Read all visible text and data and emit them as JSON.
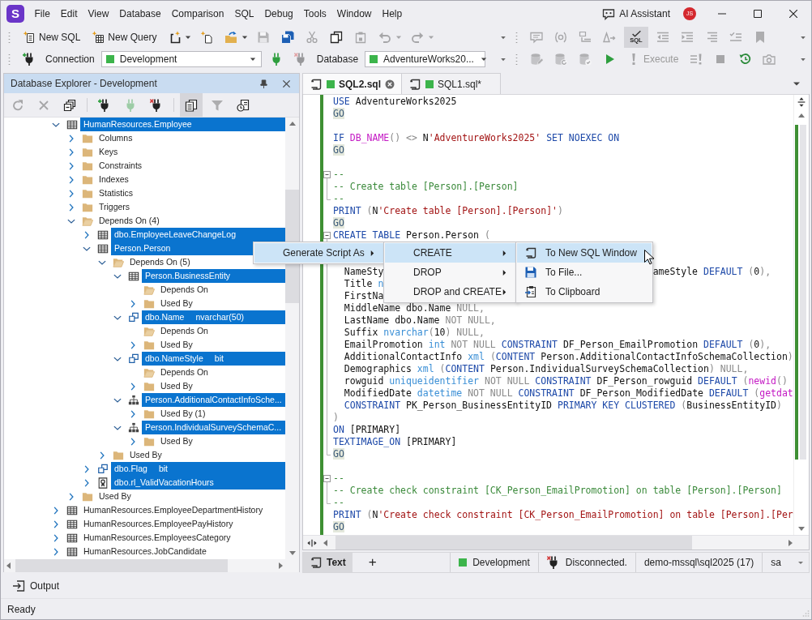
{
  "app": {
    "logo": "S",
    "menu": [
      "File",
      "Edit",
      "View",
      "Database",
      "Comparison",
      "SQL",
      "Debug",
      "Tools",
      "Window",
      "Help"
    ],
    "assistant": "AI Assistant",
    "user_initials": "JS"
  },
  "toolbars": [
    {
      "left": [
        {
          "kind": "new-sql",
          "label": "New SQL",
          "disabled": false,
          "pressed": false
        },
        {
          "kind": "new-query",
          "label": "New Query",
          "disabled": false,
          "pressed": false
        },
        {
          "kind": "new-object",
          "disabled": false,
          "pressed": false
        },
        {
          "kind": "caret",
          "disabled": false,
          "pressed": false
        },
        {
          "kind": "new-file",
          "disabled": false,
          "pressed": false
        },
        {
          "kind": "open",
          "disabled": false,
          "pressed": false
        },
        {
          "kind": "caret",
          "disabled": false,
          "pressed": false
        },
        {
          "kind": "save",
          "disabled": true,
          "pressed": false
        },
        {
          "kind": "save-all",
          "disabled": false,
          "pressed": false
        },
        {
          "kind": "cut",
          "disabled": true,
          "pressed": false
        },
        {
          "kind": "copy",
          "disabled": false,
          "pressed": false
        },
        {
          "kind": "paste",
          "disabled": true,
          "pressed": false
        },
        {
          "kind": "undo",
          "disabled": true,
          "pressed": false
        },
        {
          "kind": "caret",
          "disabled": true,
          "pressed": false
        },
        {
          "kind": "redo",
          "disabled": true,
          "pressed": false
        },
        {
          "kind": "caret",
          "disabled": true,
          "pressed": false
        },
        {
          "kind": "overflow",
          "disabled": false,
          "pressed": false
        }
      ],
      "right": [
        {
          "kind": "comment",
          "disabled": true,
          "pressed": false
        },
        {
          "kind": "params",
          "disabled": true,
          "pressed": false
        },
        {
          "kind": "text-block",
          "disabled": true,
          "pressed": false
        },
        {
          "kind": "format",
          "disabled": true,
          "pressed": false
        },
        {
          "kind": "sql-check",
          "label": "SQL",
          "disabled": false,
          "pressed": true
        },
        {
          "kind": "outdent",
          "disabled": true,
          "pressed": false
        },
        {
          "kind": "indent",
          "disabled": true,
          "pressed": false
        },
        {
          "kind": "align",
          "disabled": true,
          "pressed": false
        },
        {
          "kind": "checklist",
          "disabled": true,
          "pressed": false
        },
        {
          "kind": "bookmark",
          "disabled": true,
          "pressed": false
        },
        {
          "kind": "overflow",
          "disabled": false,
          "pressed": false
        }
      ]
    },
    {
      "left": [
        {
          "kind": "plug-add",
          "disabled": false,
          "pressed": false
        },
        {
          "kind": "label",
          "label": "Connection",
          "disabled": false,
          "pressed": false
        },
        {
          "kind": "select",
          "value": "Development",
          "color": "#3cb44b",
          "disabled": false,
          "pressed": false
        },
        {
          "kind": "plug",
          "disabled": false,
          "pressed": false
        },
        {
          "kind": "plug-remove",
          "disabled": true,
          "pressed": false
        },
        {
          "kind": "label",
          "label": "Database",
          "disabled": false,
          "pressed": false
        },
        {
          "kind": "select",
          "value": "AdventureWorks20...",
          "color": "#3cb44b",
          "disabled": false,
          "pressed": false
        },
        {
          "kind": "overflow",
          "disabled": false,
          "pressed": false
        }
      ],
      "right": [
        {
          "kind": "db-edit",
          "disabled": true,
          "pressed": false
        },
        {
          "kind": "db-refresh",
          "disabled": true,
          "pressed": false
        },
        {
          "kind": "db-check",
          "disabled": true,
          "pressed": false
        },
        {
          "kind": "play",
          "disabled": false,
          "pressed": false
        },
        {
          "kind": "execute",
          "label": "Execute",
          "disabled": true,
          "pressed": false
        },
        {
          "kind": "exec-current",
          "disabled": true,
          "pressed": false
        },
        {
          "kind": "stop",
          "disabled": true,
          "pressed": false
        },
        {
          "kind": "history",
          "disabled": false,
          "pressed": false
        },
        {
          "kind": "snapshot",
          "disabled": true,
          "pressed": false
        },
        {
          "kind": "overflow",
          "disabled": false,
          "pressed": false
        }
      ]
    }
  ],
  "explorer": {
    "title": "Database Explorer - Development",
    "tool_groups": [
      [
        {
          "kind": "refresh",
          "disabled": true,
          "pressed": false
        },
        {
          "kind": "delete",
          "disabled": true,
          "pressed": false
        },
        {
          "kind": "collapse",
          "disabled": false,
          "pressed": false
        }
      ],
      [
        {
          "kind": "plug-add",
          "disabled": false,
          "pressed": false
        },
        {
          "kind": "plug",
          "disabled": true,
          "pressed": false
        },
        {
          "kind": "plug-remove",
          "disabled": false,
          "pressed": false
        }
      ],
      [
        {
          "kind": "script",
          "disabled": false,
          "pressed": true
        },
        {
          "kind": "filter",
          "disabled": true,
          "pressed": false
        },
        {
          "kind": "schedule",
          "disabled": false,
          "pressed": false
        }
      ]
    ],
    "tree": [
      {
        "kind": "table",
        "label": "HumanResources.Employee",
        "expanded": true,
        "selected": true,
        "children": [
          {
            "kind": "folder",
            "label": "Columns",
            "expanded": false,
            "selected": false
          },
          {
            "kind": "folder",
            "label": "Keys",
            "expanded": false,
            "selected": false
          },
          {
            "kind": "folder",
            "label": "Constraints",
            "expanded": false,
            "selected": false
          },
          {
            "kind": "folder",
            "label": "Indexes",
            "expanded": false,
            "selected": false
          },
          {
            "kind": "folder",
            "label": "Statistics",
            "expanded": false,
            "selected": false
          },
          {
            "kind": "folder",
            "label": "Triggers",
            "expanded": false,
            "selected": false
          },
          {
            "kind": "folder",
            "label": "Depends On (4)",
            "expanded": true,
            "selected": false,
            "children": [
              {
                "kind": "table",
                "label": "dbo.EmployeeLeaveChangeLog",
                "expanded": false,
                "selected": true
              },
              {
                "kind": "table",
                "label": "Person.Person",
                "expanded": true,
                "selected": true,
                "children": [
                  {
                    "kind": "folder",
                    "label": "Depends On (5)",
                    "expanded": true,
                    "selected": false,
                    "children": [
                      {
                        "kind": "table",
                        "label": "Person.BusinessEntity",
                        "expanded": true,
                        "selected": true,
                        "children": [
                          {
                            "kind": "folder",
                            "label": "Depends On",
                            "expanded": true,
                            "selected": false
                          },
                          {
                            "kind": "folder",
                            "label": "Used By",
                            "expanded": false,
                            "selected": false
                          }
                        ]
                      },
                      {
                        "kind": "type",
                        "label": "dbo.Name",
                        "detail": "nvarchar(50)",
                        "expanded": true,
                        "selected": true,
                        "children": [
                          {
                            "kind": "folder",
                            "label": "Depends On",
                            "expanded": true,
                            "selected": false
                          },
                          {
                            "kind": "folder",
                            "label": "Used By",
                            "expanded": false,
                            "selected": false
                          }
                        ]
                      },
                      {
                        "kind": "type",
                        "label": "dbo.NameStyle",
                        "detail": "bit",
                        "expanded": true,
                        "selected": true,
                        "children": [
                          {
                            "kind": "folder",
                            "label": "Depends On",
                            "expanded": true,
                            "selected": false
                          },
                          {
                            "kind": "folder",
                            "label": "Used By",
                            "expanded": false,
                            "selected": false
                          }
                        ]
                      },
                      {
                        "kind": "xml-schema",
                        "label": "Person.AdditionalContactInfoSche...",
                        "expanded": true,
                        "selected": true,
                        "children": [
                          {
                            "kind": "folder",
                            "label": "Used By (1)",
                            "expanded": false,
                            "selected": false
                          }
                        ]
                      },
                      {
                        "kind": "xml-schema",
                        "label": "Person.IndividualSurveySchemaC...",
                        "expanded": true,
                        "selected": true,
                        "children": [
                          {
                            "kind": "folder",
                            "label": "Used By",
                            "expanded": false,
                            "selected": false
                          }
                        ]
                      }
                    ]
                  },
                  {
                    "kind": "folder",
                    "label": "Used By",
                    "expanded": false,
                    "selected": false
                  }
                ]
              },
              {
                "kind": "type",
                "label": "dbo.Flag",
                "detail": "bit",
                "expanded": false,
                "selected": true
              },
              {
                "kind": "rule",
                "label": "dbo.rl_ValidVacationHours",
                "expanded": false,
                "selected": true
              }
            ]
          },
          {
            "kind": "folder",
            "label": "Used By",
            "expanded": false,
            "selected": false
          }
        ]
      },
      {
        "kind": "table",
        "label": "HumanResources.EmployeeDepartmentHistory",
        "expanded": false,
        "selected": false
      },
      {
        "kind": "table",
        "label": "HumanResources.EmployeePayHistory",
        "expanded": false,
        "selected": false
      },
      {
        "kind": "table",
        "label": "HumanResources.EmployeesCategory",
        "expanded": false,
        "selected": false
      },
      {
        "kind": "table",
        "label": "HumanResources.JobCandidate",
        "expanded": false,
        "selected": false
      }
    ]
  },
  "editor": {
    "tabs": [
      {
        "label": "SQL2.sql",
        "selected": true,
        "color": "#3cb44b"
      },
      {
        "label": "SQL1.sql*",
        "selected": false,
        "color": "#3cb44b"
      }
    ],
    "lines": [
      {
        "kind": "code",
        "tokens": [
          {
            "kind": "kw",
            "text": "USE"
          },
          {
            "kind": "plain",
            "text": " AdventureWorks2025"
          }
        ]
      },
      {
        "kind": "code",
        "tokens": [
          {
            "kind": "go",
            "text": "GO"
          }
        ]
      },
      {
        "kind": "blank"
      },
      {
        "kind": "code",
        "tokens": [
          {
            "kind": "kw",
            "text": "IF "
          },
          {
            "kind": "fn",
            "text": "DB_NAME"
          },
          {
            "kind": "op",
            "text": "() <> "
          },
          {
            "kind": "plain",
            "text": "N"
          },
          {
            "kind": "str",
            "text": "'AdventureWorks2025'"
          },
          {
            "kind": "kw",
            "text": " SET NOEXEC ON"
          }
        ]
      },
      {
        "kind": "code",
        "tokens": [
          {
            "kind": "go",
            "text": "GO"
          }
        ]
      },
      {
        "kind": "blank"
      },
      {
        "kind": "code",
        "fold": {
          "kind": "start",
          "expanded": true
        },
        "tokens": [
          {
            "kind": "comment",
            "text": "--"
          }
        ]
      },
      {
        "kind": "code",
        "fold": {
          "kind": "inside"
        },
        "tokens": [
          {
            "kind": "comment",
            "text": "-- Create table [Person].[Person]"
          }
        ]
      },
      {
        "kind": "code",
        "fold": {
          "kind": "end"
        },
        "tokens": [
          {
            "kind": "comment",
            "text": "--"
          }
        ]
      },
      {
        "kind": "code",
        "tokens": [
          {
            "kind": "kw",
            "text": "PRINT"
          },
          {
            "kind": "op",
            "text": " ("
          },
          {
            "kind": "plain",
            "text": "N"
          },
          {
            "kind": "str",
            "text": "'Create table [Person].[Person]'"
          },
          {
            "kind": "op",
            "text": ")"
          }
        ]
      },
      {
        "kind": "code",
        "tokens": [
          {
            "kind": "go",
            "text": "GO"
          }
        ]
      },
      {
        "kind": "code",
        "fold": {
          "kind": "start",
          "expanded": true
        },
        "tokens": [
          {
            "kind": "kw",
            "text": "CREATE TABLE"
          },
          {
            "kind": "plain",
            "text": " Person.Person "
          },
          {
            "kind": "op",
            "text": "("
          }
        ]
      },
      {
        "kind": "blank",
        "fold": {
          "kind": "inside"
        }
      },
      {
        "kind": "blank",
        "fold": {
          "kind": "inside"
        }
      },
      {
        "kind": "split",
        "fold": {
          "kind": "inside"
        },
        "tokens": [
          {
            "kind": "plain",
            "text": "  NameSty"
          }
        ],
        "tail": [
          {
            "kind": "plain",
            "text": "ameStyle "
          },
          {
            "kind": "kw",
            "text": "DEFAULT"
          },
          {
            "kind": "op",
            "text": " ("
          },
          {
            "kind": "plain",
            "text": "0"
          },
          {
            "kind": "op",
            "text": "),"
          }
        ]
      },
      {
        "kind": "code",
        "fold": {
          "kind": "inside"
        },
        "tokens": [
          {
            "kind": "plain",
            "text": "  Title "
          },
          {
            "kind": "type",
            "text": "n"
          }
        ]
      },
      {
        "kind": "code",
        "fold": {
          "kind": "inside"
        },
        "tokens": [
          {
            "kind": "plain",
            "text": "  FirstNa"
          }
        ]
      },
      {
        "kind": "code",
        "fold": {
          "kind": "inside"
        },
        "tokens": [
          {
            "kind": "plain",
            "text": "  MiddleName dbo.Name "
          },
          {
            "kind": "op",
            "text": "NULL,"
          }
        ]
      },
      {
        "kind": "code",
        "fold": {
          "kind": "inside"
        },
        "tokens": [
          {
            "kind": "plain",
            "text": "  LastName dbo.Name "
          },
          {
            "kind": "op",
            "text": "NOT NULL,"
          }
        ]
      },
      {
        "kind": "code",
        "fold": {
          "kind": "inside"
        },
        "tokens": [
          {
            "kind": "plain",
            "text": "  Suffix "
          },
          {
            "kind": "type",
            "text": "nvarchar"
          },
          {
            "kind": "op",
            "text": "("
          },
          {
            "kind": "plain",
            "text": "10"
          },
          {
            "kind": "op",
            "text": ") NULL,"
          }
        ]
      },
      {
        "kind": "code",
        "fold": {
          "kind": "inside"
        },
        "tokens": [
          {
            "kind": "plain",
            "text": "  EmailPromotion "
          },
          {
            "kind": "type",
            "text": "int"
          },
          {
            "kind": "op",
            "text": " NOT NULL "
          },
          {
            "kind": "kw",
            "text": "CONSTRAINT"
          },
          {
            "kind": "plain",
            "text": " DF_Person_EmailPromotion "
          },
          {
            "kind": "kw",
            "text": "DEFAULT"
          },
          {
            "kind": "op",
            "text": " ("
          },
          {
            "kind": "plain",
            "text": "0"
          },
          {
            "kind": "op",
            "text": "),"
          }
        ]
      },
      {
        "kind": "code",
        "fold": {
          "kind": "inside"
        },
        "tokens": [
          {
            "kind": "plain",
            "text": "  AdditionalContactInfo "
          },
          {
            "kind": "type",
            "text": "xml"
          },
          {
            "kind": "op",
            "text": " ("
          },
          {
            "kind": "kw",
            "text": "CONTENT"
          },
          {
            "kind": "plain",
            "text": " Person.AdditionalContactInfoSchemaCollection"
          },
          {
            "kind": "op",
            "text": ")"
          }
        ]
      },
      {
        "kind": "code",
        "fold": {
          "kind": "inside"
        },
        "tokens": [
          {
            "kind": "plain",
            "text": "  Demographics "
          },
          {
            "kind": "type",
            "text": "xml"
          },
          {
            "kind": "op",
            "text": " ("
          },
          {
            "kind": "kw",
            "text": "CONTENT"
          },
          {
            "kind": "plain",
            "text": " Person.IndividualSurveySchemaCollection"
          },
          {
            "kind": "op",
            "text": ") NULL,"
          }
        ]
      },
      {
        "kind": "code",
        "fold": {
          "kind": "inside"
        },
        "tokens": [
          {
            "kind": "plain",
            "text": "  rowguid "
          },
          {
            "kind": "type",
            "text": "uniqueidentifier"
          },
          {
            "kind": "op",
            "text": " NOT NULL "
          },
          {
            "kind": "kw",
            "text": "CONSTRAINT"
          },
          {
            "kind": "plain",
            "text": " DF_Person_rowguid "
          },
          {
            "kind": "kw",
            "text": "DEFAULT"
          },
          {
            "kind": "op",
            "text": " ("
          },
          {
            "kind": "fn",
            "text": "newid"
          },
          {
            "kind": "op",
            "text": "()"
          }
        ]
      },
      {
        "kind": "code",
        "fold": {
          "kind": "inside"
        },
        "tokens": [
          {
            "kind": "plain",
            "text": "  ModifiedDate "
          },
          {
            "kind": "type",
            "text": "datetime"
          },
          {
            "kind": "op",
            "text": " NOT NULL "
          },
          {
            "kind": "kw",
            "text": "CONSTRAINT"
          },
          {
            "kind": "plain",
            "text": " DF_Person_ModifiedDate "
          },
          {
            "kind": "kw",
            "text": "DEFAULT"
          },
          {
            "kind": "op",
            "text": " ("
          },
          {
            "kind": "fn",
            "text": "getdat"
          }
        ]
      },
      {
        "kind": "code",
        "fold": {
          "kind": "inside"
        },
        "tokens": [
          {
            "kind": "kw",
            "text": "  CONSTRAINT"
          },
          {
            "kind": "plain",
            "text": " PK_Person_BusinessEntityID "
          },
          {
            "kind": "kw",
            "text": "PRIMARY KEY CLUSTERED"
          },
          {
            "kind": "op",
            "text": " ("
          },
          {
            "kind": "plain",
            "text": "BusinessEntityID"
          },
          {
            "kind": "op",
            "text": ")"
          }
        ]
      },
      {
        "kind": "code",
        "fold": {
          "kind": "inside"
        },
        "tokens": [
          {
            "kind": "op",
            "text": ")"
          }
        ]
      },
      {
        "kind": "code",
        "fold": {
          "kind": "inside"
        },
        "tokens": [
          {
            "kind": "kw",
            "text": "ON"
          },
          {
            "kind": "plain",
            "text": " [PRIMARY]"
          }
        ]
      },
      {
        "kind": "code",
        "fold": {
          "kind": "inside"
        },
        "tokens": [
          {
            "kind": "kw",
            "text": "TEXTIMAGE_ON"
          },
          {
            "kind": "plain",
            "text": " [PRIMARY]"
          }
        ]
      },
      {
        "kind": "code",
        "fold": {
          "kind": "end"
        },
        "tokens": [
          {
            "kind": "go",
            "text": "GO"
          }
        ]
      },
      {
        "kind": "blank"
      },
      {
        "kind": "code",
        "fold": {
          "kind": "start",
          "expanded": true
        },
        "tokens": [
          {
            "kind": "comment",
            "text": "--"
          }
        ]
      },
      {
        "kind": "code",
        "fold": {
          "kind": "inside"
        },
        "tokens": [
          {
            "kind": "comment",
            "text": "-- Create check constraint [CK_Person_EmailPromotion] on table [Person].[Person]"
          }
        ]
      },
      {
        "kind": "code",
        "fold": {
          "kind": "end"
        },
        "tokens": [
          {
            "kind": "comment",
            "text": "--"
          }
        ]
      },
      {
        "kind": "code",
        "tokens": [
          {
            "kind": "kw",
            "text": "PRINT"
          },
          {
            "kind": "op",
            "text": " ("
          },
          {
            "kind": "plain",
            "text": "N"
          },
          {
            "kind": "str",
            "text": "'Create check constraint [CK_Person_EmailPromotion] on table [Person].[Per"
          }
        ]
      },
      {
        "kind": "code",
        "tokens": [
          {
            "kind": "go",
            "text": "GO"
          }
        ]
      }
    ]
  },
  "context_menus": [
    {
      "items": [
        {
          "label": "Generate Script As",
          "submenu": true,
          "selected": true
        }
      ]
    },
    {
      "items": [
        {
          "label": "CREATE",
          "submenu": true,
          "selected": true
        },
        {
          "label": "DROP",
          "submenu": true,
          "selected": false
        },
        {
          "label": "DROP and CREATE",
          "submenu": true,
          "selected": false
        }
      ]
    },
    {
      "items": [
        {
          "kind": "new-window",
          "label": "To New SQL Window",
          "selected": true
        },
        {
          "kind": "save-file",
          "label": "To File...",
          "selected": false
        },
        {
          "kind": "clipboard",
          "label": "To Clipboard",
          "selected": false
        }
      ]
    }
  ],
  "bottom_bar": {
    "buttons": [
      {
        "kind": "text-mode",
        "label": "Text",
        "pressed": true
      },
      {
        "kind": "add",
        "label": "+",
        "pressed": false
      }
    ],
    "status": [
      {
        "kind": "connection",
        "label": "Development",
        "color": "#3cb44b"
      },
      {
        "kind": "disconnected",
        "label": "Disconnected."
      },
      {
        "kind": "server",
        "label": "demo-mssql\\sql2025 (17)"
      },
      {
        "kind": "user",
        "label": "sa"
      }
    ]
  },
  "output": {
    "label": "Output"
  },
  "status_bar": {
    "text": "Ready"
  }
}
